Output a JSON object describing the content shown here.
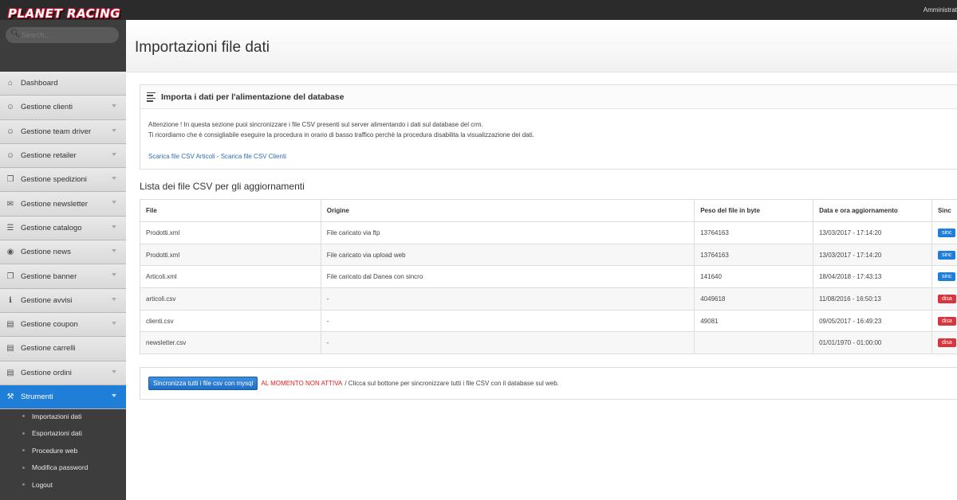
{
  "brand": {
    "logo_text": "PLANET RACING",
    "accent": "#c8102e"
  },
  "topbar": {
    "user_label": "Amministrat"
  },
  "sidebar": {
    "search_placeholder": "Search...",
    "items": [
      {
        "label": "Dashboard",
        "icon": "home-icon",
        "has_caret": false,
        "active": false
      },
      {
        "label": "Gestione clienti",
        "icon": "user-icon",
        "has_caret": true,
        "active": false
      },
      {
        "label": "Gestione team driver",
        "icon": "user-icon",
        "has_caret": true,
        "active": false
      },
      {
        "label": "Gestione retailer",
        "icon": "user-icon",
        "has_caret": true,
        "active": false
      },
      {
        "label": "Gestione spedizioni",
        "icon": "copy-icon",
        "has_caret": true,
        "active": false
      },
      {
        "label": "Gestione newsletter",
        "icon": "envelope-icon",
        "has_caret": true,
        "active": false
      },
      {
        "label": "Gestione catalogo",
        "icon": "list-icon",
        "has_caret": true,
        "active": false
      },
      {
        "label": "Gestione news",
        "icon": "broadcast-icon",
        "has_caret": true,
        "active": false
      },
      {
        "label": "Gestione banner",
        "icon": "copy-icon",
        "has_caret": true,
        "active": false
      },
      {
        "label": "Gestione avvisi",
        "icon": "info-icon",
        "has_caret": true,
        "active": false
      },
      {
        "label": "Gestione coupon",
        "icon": "folder-icon",
        "has_caret": true,
        "active": false
      },
      {
        "label": "Gestione carrelli",
        "icon": "folder-icon",
        "has_caret": false,
        "active": false
      },
      {
        "label": "Gestione ordini",
        "icon": "folder-icon",
        "has_caret": true,
        "active": false
      },
      {
        "label": "Strumenti",
        "icon": "wrench-icon",
        "has_caret": true,
        "active": true
      }
    ],
    "subitems": [
      {
        "label": "Importazioni dati"
      },
      {
        "label": "Esportazioni dati"
      },
      {
        "label": "Procedure web"
      },
      {
        "label": "Modifica password"
      },
      {
        "label": "Logout"
      }
    ]
  },
  "page": {
    "title": "Importazioni file dati"
  },
  "panel": {
    "title": "Importa i dati per l'alimentazione del database",
    "line1": "Attenzione ! In questa sezione puoi sincronizzare i file CSV presenti sul server alimentando i dati sul database del crm.",
    "line2": "Ti ricordiamo che è consigliabile eseguire la procedura in orario di basso traffico perchè la procedura disabilita la visualizzazione dei dati.",
    "link1": "Scarica file CSV Articoli",
    "link_sep": " - ",
    "link2": "Scarica file CSV Clienti"
  },
  "table": {
    "title": "Lista dei file CSV per gli aggiornamenti",
    "headers": [
      "File",
      "Origine",
      "Peso del file in byte",
      "Data e ora aggiornamento",
      "Sinc"
    ],
    "rows": [
      {
        "file": "Prodotti.xml",
        "origin": "File caricato via ftp",
        "size": "13764163",
        "date": "13/03/2017 - 17:14:20",
        "badge": "sinc",
        "badge_state": "on"
      },
      {
        "file": "Prodotti.xml",
        "origin": "File caricato via upload web",
        "size": "13764163",
        "date": "13/03/2017 - 17:14:20",
        "badge": "sinc",
        "badge_state": "on"
      },
      {
        "file": "Articoli.xml",
        "origin": "File caricato dal Danea con sincro",
        "size": "141640",
        "date": "18/04/2018 - 17:43:13",
        "badge": "sinc",
        "badge_state": "on"
      },
      {
        "file": "articoli.csv",
        "origin": "-",
        "size": "4049618",
        "date": "11/08/2016 - 16:50:13",
        "badge": "disa",
        "badge_state": "off"
      },
      {
        "file": "clienti.csv",
        "origin": "-",
        "size": "49081",
        "date": "09/05/2017 - 16:49:23",
        "badge": "disa",
        "badge_state": "off"
      },
      {
        "file": "newsletter.csv",
        "origin": "-",
        "size": "",
        "date": "01/01/1970 - 01:00:00",
        "badge": "disa",
        "badge_state": "off"
      }
    ]
  },
  "bottom": {
    "button_label": "Sincronizza tutti i file csv con mysql",
    "status": "AL MOMENTO NON ATTIVA",
    "description": "/ Clicca sul bottone per sincronizzare tutti i file CSV con il database sul web."
  },
  "colors": {
    "active_menu": "#1f7fd8",
    "badge_on": "#1f7fd8",
    "badge_off": "#d6363f",
    "warn_text": "#e02020"
  }
}
